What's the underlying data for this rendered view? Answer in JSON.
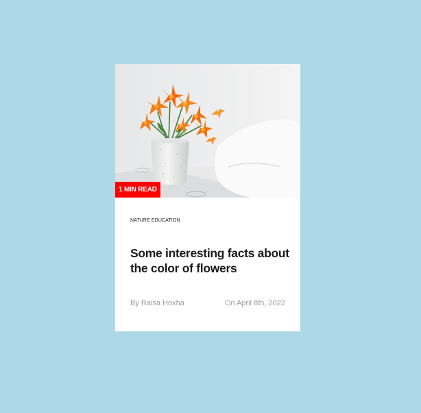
{
  "card": {
    "image_alt": "orange-lilies-photo",
    "badge": "1 MIN READ",
    "category": "NATURE EDUCATION",
    "title": "Some interesting facts about the color of flowers",
    "author": "By Raisa Hoxha",
    "date": "On April 8th, 2022"
  },
  "colors": {
    "page_background": "#add8e6",
    "card_background": "#ffffff",
    "badge_background": "#ff0000",
    "title_text": "#1c1c1c",
    "meta_text": "#9a9a9a"
  }
}
